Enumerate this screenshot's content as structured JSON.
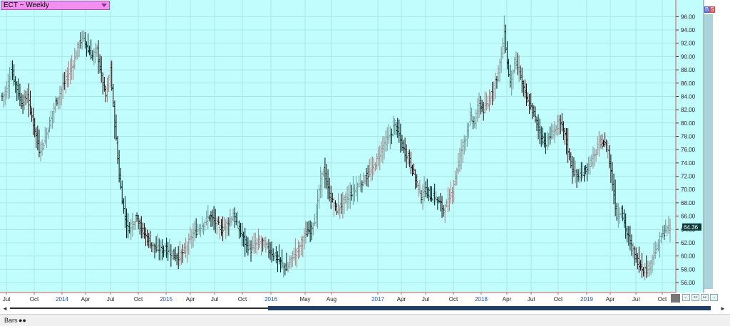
{
  "header": {
    "title": "ECT ~ Weekly",
    "badge_b": "B",
    "badge_s": "S"
  },
  "footer": {
    "tab_label": "Bars",
    "tab_glyph": "●●",
    "scroll_left_glyph": "◄",
    "scroll_right_glyph": "►"
  },
  "nav_buttons": [
    "←",
    "↤",
    "↦",
    "→"
  ],
  "colors": {
    "plot_bg": "#c2fdfd",
    "grid": "#a8e6e6",
    "axis_line": "#d7585c",
    "bar_black": "#101010",
    "bar_gray": "#8c8c8c",
    "last_price_bg": "#0a3a3a",
    "right_gutter": "#a9d4dc",
    "scroll_thumb": "#1f3e66",
    "year_label": "#1a56c4"
  },
  "chart_data": {
    "type": "bar",
    "style": "ohlc",
    "symbol": "ECT",
    "period": "Weekly",
    "last_price_label": "64.36",
    "ylim": [
      54.5,
      98.5
    ],
    "y_ticks": [
      "56.00",
      "58.00",
      "60.00",
      "62.00",
      "64.00",
      "66.00",
      "68.00",
      "70.00",
      "72.00",
      "74.00",
      "76.00",
      "78.00",
      "80.00",
      "82.00",
      "84.00",
      "86.00",
      "88.00",
      "90.00",
      "92.00",
      "94.00",
      "96.00"
    ],
    "x_labels": [
      {
        "label": "Jul",
        "year": false
      },
      {
        "label": "Oct",
        "year": false
      },
      {
        "label": "2014",
        "year": true
      },
      {
        "label": "Apr",
        "year": false
      },
      {
        "label": "Jul",
        "year": false
      },
      {
        "label": "Oct",
        "year": false
      },
      {
        "label": "2015",
        "year": true
      },
      {
        "label": "Apr",
        "year": false
      },
      {
        "label": "Jul",
        "year": false
      },
      {
        "label": "Oct",
        "year": false
      },
      {
        "label": "2016",
        "year": true
      },
      {
        "label": "May",
        "year": false
      },
      {
        "label": "Aug",
        "year": false
      },
      {
        "label": "2017",
        "year": true
      },
      {
        "label": "Apr",
        "year": false
      },
      {
        "label": "Jul",
        "year": false
      },
      {
        "label": "Oct",
        "year": false
      },
      {
        "label": "2018",
        "year": true
      },
      {
        "label": "Apr",
        "year": false
      },
      {
        "label": "Jul",
        "year": false
      },
      {
        "label": "Oct",
        "year": false
      },
      {
        "label": "2019",
        "year": true
      },
      {
        "label": "Apr",
        "year": false
      },
      {
        "label": "Jul",
        "year": false
      },
      {
        "label": "Oct",
        "year": false
      }
    ],
    "anchors": [
      [
        0,
        84
      ],
      [
        3,
        85
      ],
      [
        6,
        88
      ],
      [
        9,
        86
      ],
      [
        13,
        83
      ],
      [
        17,
        84
      ],
      [
        21,
        80
      ],
      [
        25,
        76
      ],
      [
        28,
        77
      ],
      [
        32,
        80
      ],
      [
        36,
        83
      ],
      [
        40,
        85
      ],
      [
        44,
        87
      ],
      [
        48,
        89
      ],
      [
        52,
        92
      ],
      [
        55,
        93
      ],
      [
        58,
        91
      ],
      [
        61,
        90
      ],
      [
        64,
        91
      ],
      [
        67,
        87
      ],
      [
        70,
        84
      ],
      [
        73,
        88
      ],
      [
        76,
        80
      ],
      [
        79,
        72
      ],
      [
        82,
        67
      ],
      [
        85,
        64
      ],
      [
        88,
        65
      ],
      [
        91,
        66
      ],
      [
        94,
        64
      ],
      [
        97,
        63
      ],
      [
        100,
        62
      ],
      [
        104,
        61
      ],
      [
        108,
        61
      ],
      [
        112,
        61
      ],
      [
        116,
        60
      ],
      [
        120,
        60
      ],
      [
        124,
        61
      ],
      [
        128,
        63
      ],
      [
        132,
        64
      ],
      [
        136,
        65
      ],
      [
        140,
        66
      ],
      [
        144,
        65
      ],
      [
        148,
        64
      ],
      [
        152,
        65
      ],
      [
        156,
        66
      ],
      [
        160,
        64
      ],
      [
        164,
        62
      ],
      [
        168,
        61
      ],
      [
        172,
        62
      ],
      [
        176,
        62
      ],
      [
        180,
        61
      ],
      [
        184,
        60
      ],
      [
        188,
        59
      ],
      [
        192,
        58
      ],
      [
        196,
        60
      ],
      [
        200,
        61
      ],
      [
        204,
        63
      ],
      [
        208,
        64
      ],
      [
        212,
        66
      ],
      [
        214,
        70
      ],
      [
        217,
        73
      ],
      [
        220,
        70
      ],
      [
        223,
        68
      ],
      [
        226,
        67
      ],
      [
        230,
        68
      ],
      [
        234,
        69
      ],
      [
        238,
        70
      ],
      [
        242,
        71
      ],
      [
        246,
        72
      ],
      [
        250,
        73
      ],
      [
        254,
        75
      ],
      [
        258,
        77
      ],
      [
        262,
        78
      ],
      [
        265,
        80
      ],
      [
        268,
        78
      ],
      [
        271,
        76
      ],
      [
        274,
        75
      ],
      [
        277,
        73
      ],
      [
        280,
        71
      ],
      [
        283,
        69
      ],
      [
        286,
        70
      ],
      [
        289,
        69
      ],
      [
        292,
        69
      ],
      [
        295,
        68
      ],
      [
        298,
        67
      ],
      [
        301,
        68
      ],
      [
        304,
        70
      ],
      [
        307,
        73
      ],
      [
        310,
        76
      ],
      [
        313,
        78
      ],
      [
        316,
        81
      ],
      [
        319,
        80
      ],
      [
        322,
        83
      ],
      [
        325,
        82
      ],
      [
        328,
        83
      ],
      [
        331,
        85
      ],
      [
        334,
        87
      ],
      [
        337,
        90
      ],
      [
        339,
        94
      ],
      [
        341,
        89
      ],
      [
        343,
        86
      ],
      [
        346,
        89
      ],
      [
        349,
        88
      ],
      [
        352,
        85
      ],
      [
        355,
        83
      ],
      [
        358,
        82
      ],
      [
        361,
        80
      ],
      [
        364,
        78
      ],
      [
        367,
        77
      ],
      [
        370,
        78
      ],
      [
        373,
        79
      ],
      [
        376,
        80
      ],
      [
        379,
        79
      ],
      [
        382,
        76
      ],
      [
        385,
        73
      ],
      [
        388,
        72
      ],
      [
        391,
        72
      ],
      [
        394,
        73
      ],
      [
        397,
        74
      ],
      [
        400,
        75
      ],
      [
        403,
        77
      ],
      [
        406,
        77
      ],
      [
        409,
        76
      ],
      [
        412,
        71
      ],
      [
        415,
        66
      ],
      [
        418,
        67
      ],
      [
        421,
        64
      ],
      [
        424,
        62
      ],
      [
        427,
        60
      ],
      [
        430,
        59
      ],
      [
        433,
        58
      ],
      [
        436,
        58
      ],
      [
        439,
        60
      ],
      [
        442,
        61
      ],
      [
        445,
        63
      ],
      [
        448,
        64
      ],
      [
        451,
        64
      ]
    ]
  }
}
